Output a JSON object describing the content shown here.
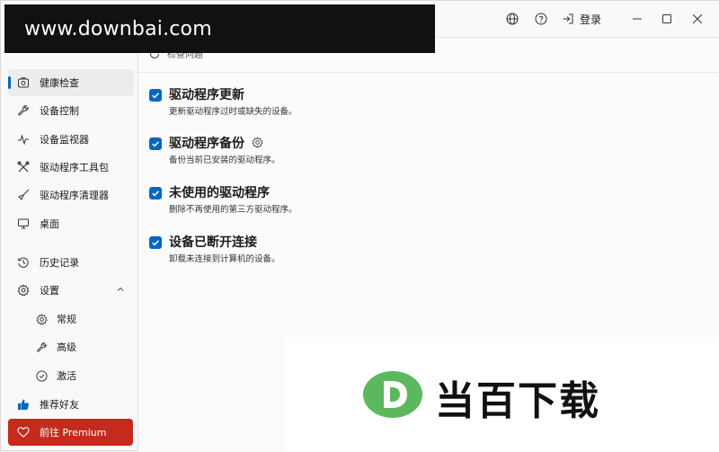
{
  "watermark": {
    "top_text": "www.downbai.com",
    "bottom_text": "当百下载"
  },
  "titlebar": {
    "login_label": "登录"
  },
  "scan": {
    "label": "检查问题"
  },
  "sidebar": {
    "items": [
      {
        "label": "健康检查",
        "icon": "health-check-icon"
      },
      {
        "label": "设备控制",
        "icon": "wrench-icon"
      },
      {
        "label": "设备监视器",
        "icon": "pulse-icon"
      },
      {
        "label": "驱动程序工具包",
        "icon": "tools-icon"
      },
      {
        "label": "驱动程序清理器",
        "icon": "broom-icon"
      },
      {
        "label": "桌面",
        "icon": "monitor-icon"
      },
      {
        "label": "历史记录",
        "icon": "history-icon"
      },
      {
        "label": "设置",
        "icon": "gear-icon"
      }
    ],
    "sub_items": [
      {
        "label": "常规",
        "icon": "gear-icon"
      },
      {
        "label": "高级",
        "icon": "wrench-icon"
      },
      {
        "label": "激活",
        "icon": "check-circle-icon"
      }
    ],
    "recommend": {
      "label": "推荐好友",
      "icon": "thumbs-up-icon"
    },
    "premium": {
      "label": "前往 Premium",
      "icon": "heart-icon"
    }
  },
  "options": [
    {
      "title": "驱动程序更新",
      "desc": "更新驱动程序过时或缺失的设备。",
      "checked": true
    },
    {
      "title": "驱动程序备份",
      "desc": "备份当前已安装的驱动程序。",
      "checked": true
    },
    {
      "title": "未使用的驱动程序",
      "desc": "删除不再使用的第三方驱动程序。",
      "checked": true
    },
    {
      "title": "设备已断开连接",
      "desc": "卸载未连接到计算机的设备。",
      "checked": true
    }
  ],
  "colors": {
    "accent": "#0067c0",
    "premium": "#c42b1c",
    "logo_green": "#5cb85c"
  }
}
